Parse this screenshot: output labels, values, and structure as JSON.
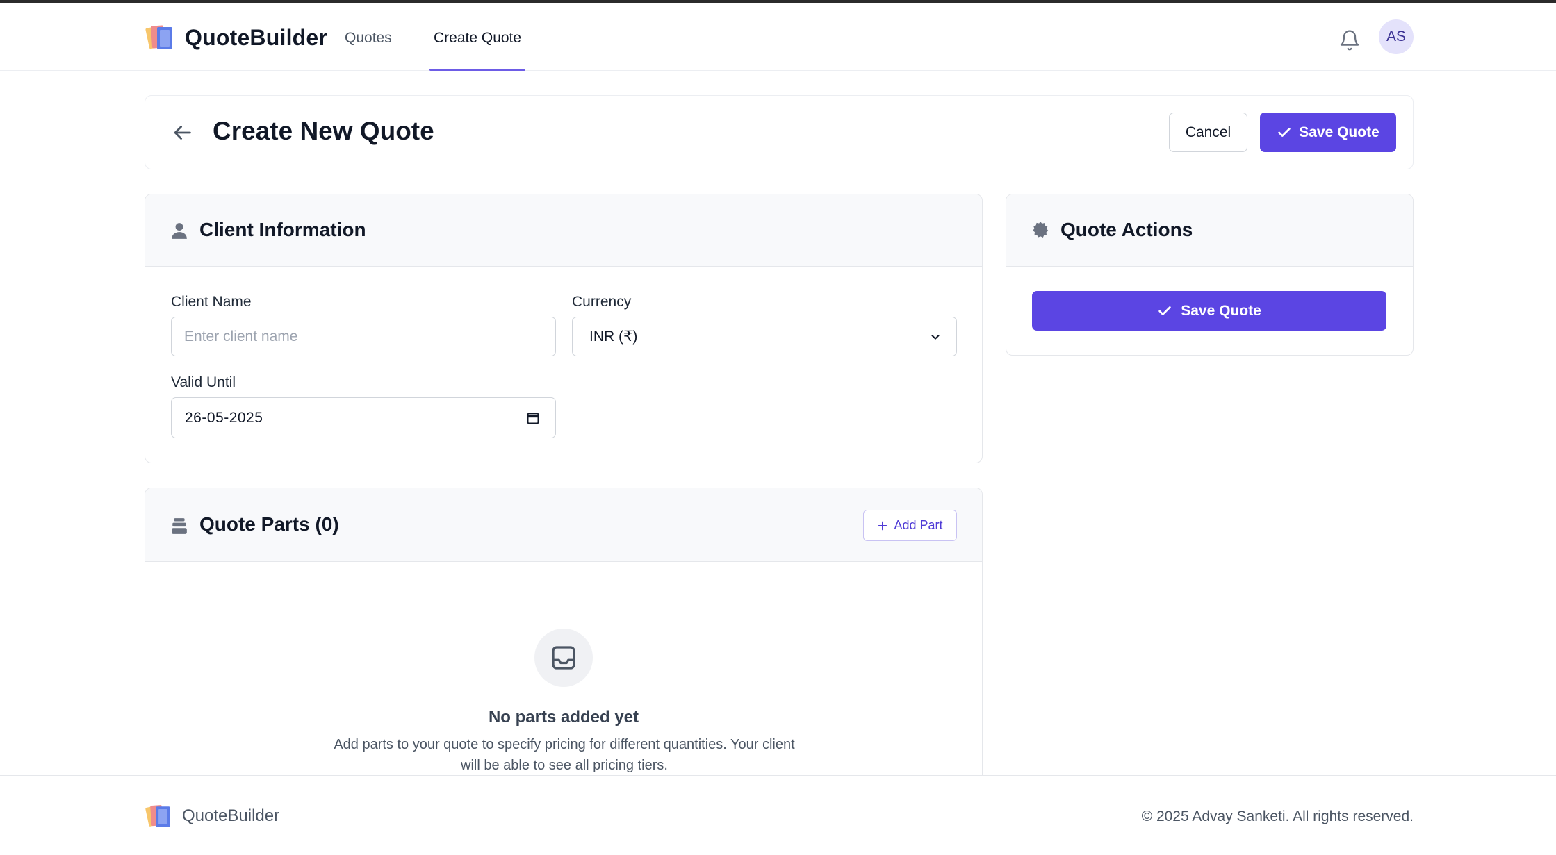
{
  "app": {
    "name": "QuoteBuilder"
  },
  "nav": {
    "quotes": "Quotes",
    "create_quote": "Create Quote"
  },
  "user": {
    "initials": "AS"
  },
  "page": {
    "title": "Create New Quote",
    "cancel_label": "Cancel",
    "save_label": "Save Quote"
  },
  "client_info": {
    "title": "Client Information",
    "client_name_label": "Client Name",
    "client_name_placeholder": "Enter client name",
    "client_name_value": "",
    "currency_label": "Currency",
    "currency_value": "INR (₹)",
    "valid_until_label": "Valid Until",
    "valid_until_value": "26-05-2025"
  },
  "actions": {
    "title": "Quote Actions",
    "save_label": "Save Quote"
  },
  "parts": {
    "title": "Quote Parts (0)",
    "add_label": "Add Part",
    "empty_title": "No parts added yet",
    "empty_desc": "Add parts to your quote to specify pricing for different quantities. Your client will be able to see all pricing tiers."
  },
  "footer": {
    "brand": "QuoteBuilder",
    "copyright": "© 2025 Advay Sanketi. All rights reserved."
  },
  "colors": {
    "accent": "#5b45e3",
    "nav_underline": "#6d5ce6",
    "avatar_bg": "#e4e2fb"
  },
  "icons": {
    "logo": "stacked-books-logo",
    "bell": "bell-icon",
    "back": "arrow-left-icon",
    "check": "check-icon",
    "user": "user-icon",
    "gear": "gear-icon",
    "parts": "stack-icon",
    "plus": "plus-icon",
    "calendar": "calendar-icon",
    "chevron": "chevron-down-icon",
    "inbox": "inbox-icon"
  }
}
